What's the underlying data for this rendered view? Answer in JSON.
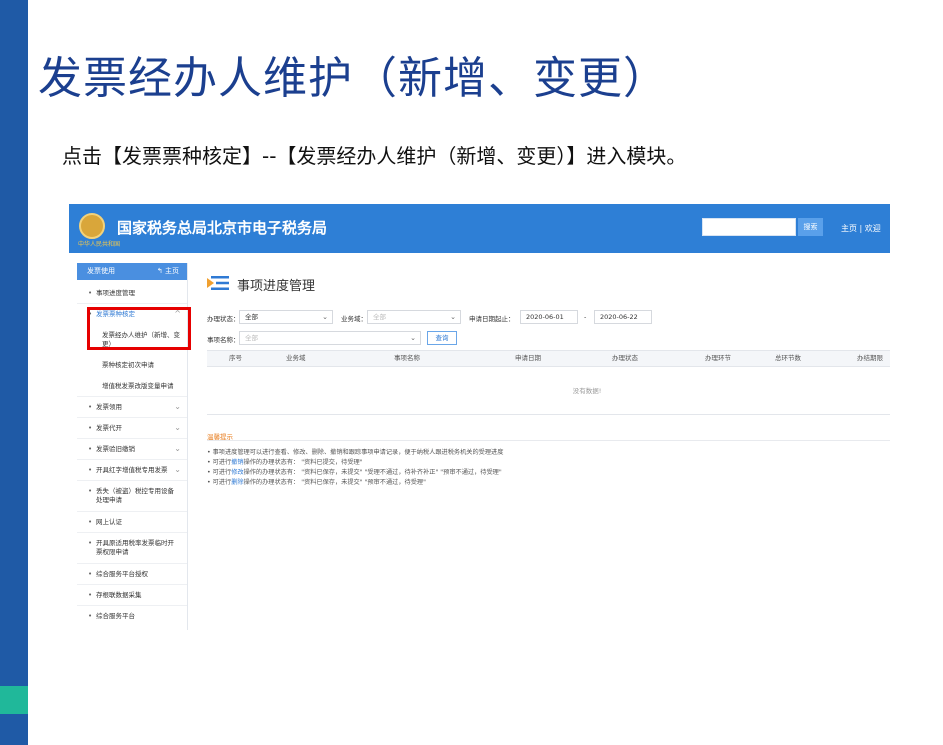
{
  "slide": {
    "title": "发票经办人维护（新增、变更）",
    "subtitle": "点击【发票票种核定】--【发票经办人维护（新增、变更）】进入模块。",
    "colors": {
      "left_bar": "#1f5aa6",
      "accent_block": "#20b89a",
      "title": "#1b3f8f",
      "highlight_box": "#e60000"
    }
  },
  "app": {
    "emblem_caption": "中华人民共和国",
    "title": "国家税务总局北京市电子税务局",
    "search_button": "搜索",
    "top_links": "主页 | 欢迎",
    "brand_color": "#2e7fd6"
  },
  "sidebar": {
    "header_label": "发票使用",
    "header_home": "主页",
    "items": [
      {
        "label": "事项进度管理"
      },
      {
        "label": "发票票种核定",
        "active": true
      },
      {
        "label": "发票领用"
      },
      {
        "label": "发票代开"
      },
      {
        "label": "发票验旧缴销"
      },
      {
        "label": "开具红字增值税专用发票"
      },
      {
        "label": "丢失（被盗）税控专用设备处理申请"
      },
      {
        "label": "网上认证"
      },
      {
        "label": "开具原适用税率发票临时开票权限申请"
      },
      {
        "label": "综合服务平台授权"
      },
      {
        "label": "存根联数据采集"
      },
      {
        "label": "综合服务平台"
      }
    ],
    "subitems": [
      "发票经办人维护（新增、变更）",
      "票种核定初次申请",
      "增值税发票改版变量申请"
    ]
  },
  "main": {
    "page_title": "事项进度管理",
    "filters": {
      "status_label": "办理状态：",
      "status_value": "全部",
      "domain_label": "业务域：",
      "domain_placeholder": "全部",
      "date_label": "申请日期起止：",
      "date_from": "2020-06-01",
      "date_sep": "-",
      "date_to": "2020-06-22",
      "name_label": "事项名称：",
      "name_placeholder": "全部",
      "query_button": "查询"
    },
    "table": {
      "columns": [
        "序号",
        "业务域",
        "事项名称",
        "申请日期",
        "办理状态",
        "办理环节",
        "总环节数",
        "办结期限"
      ],
      "empty_text": "没有数据!"
    },
    "tips": {
      "title": "温馨提示",
      "lines": [
        {
          "pre": "• 事项进度管理可以进行查看、修改、删除、撤销和跟踪事项申请记录，便于纳税人跟进税务机关的受理进度",
          "hl": "",
          "post": ""
        },
        {
          "pre": "• 可进行",
          "hl": "撤销",
          "post": "操作的办理状态有：  \"资料已提交，待受理\""
        },
        {
          "pre": "• 可进行",
          "hl": "修改",
          "post": "操作的办理状态有：  \"资料已保存，未提交\"   \"受理不通过，待补齐补正\"   \"预审不通过，待受理\""
        },
        {
          "pre": "• 可进行",
          "hl": "删除",
          "post": "操作的办理状态有：  \"资料已保存，未提交\"   \"预审不通过，待受理\""
        }
      ]
    }
  }
}
